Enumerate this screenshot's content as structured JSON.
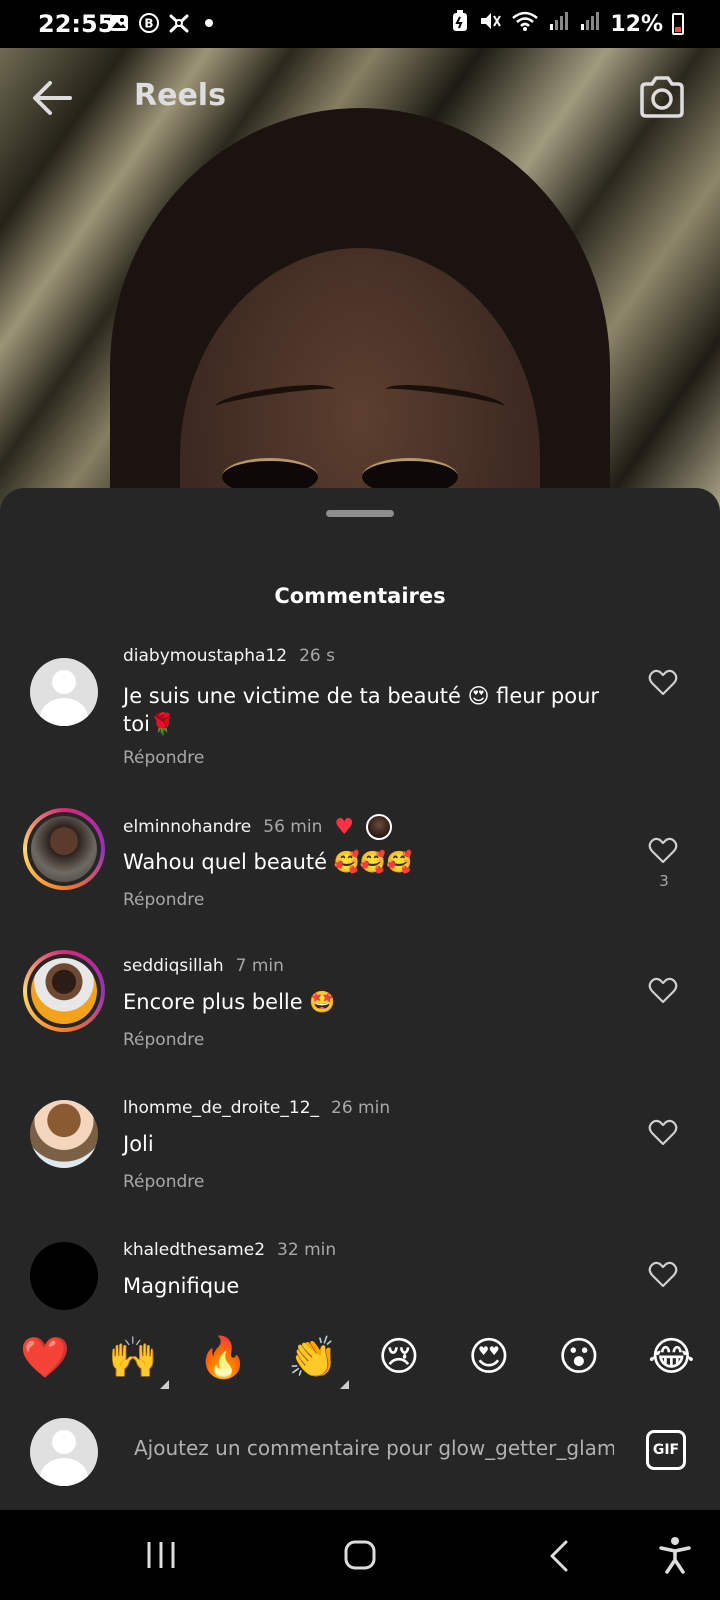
{
  "status_bar": {
    "time": "22:55",
    "battery": "12%"
  },
  "header": {
    "title": "Reels"
  },
  "sheet": {
    "title": "Commentaires"
  },
  "comments": [
    {
      "username": "diabymoustapha12",
      "time": "26 s",
      "text": "Je suis une victime de ta beauté 😍 fleur pour toi🌹",
      "reply": "Répondre"
    },
    {
      "username": "elminnohandre",
      "time": "56 min",
      "text": "Wahou quel beauté 🥰🥰🥰",
      "reply": "Répondre",
      "likes": "3"
    },
    {
      "username": "seddiqsillah",
      "time": "7 min",
      "text": "Encore plus belle 🤩",
      "reply": "Répondre"
    },
    {
      "username": "lhomme_de_droite_12_",
      "time": "26 min",
      "text": "Joli",
      "reply": "Répondre"
    },
    {
      "username": "khaledthesame2",
      "time": "32 min",
      "text": "Magnifique",
      "reply": ""
    }
  ],
  "emoji_reactions": [
    "❤️",
    "🙌",
    "🔥",
    "👏",
    "😢",
    "😍",
    "😮",
    "😂"
  ],
  "input": {
    "placeholder": "Ajoutez un commentaire pour glow_getter_glam"
  },
  "gif_label": "GIF",
  "colors": {
    "sheet_bg": "#262626",
    "muted_text": "#a8a8a8",
    "like_red": "#ff3040"
  }
}
